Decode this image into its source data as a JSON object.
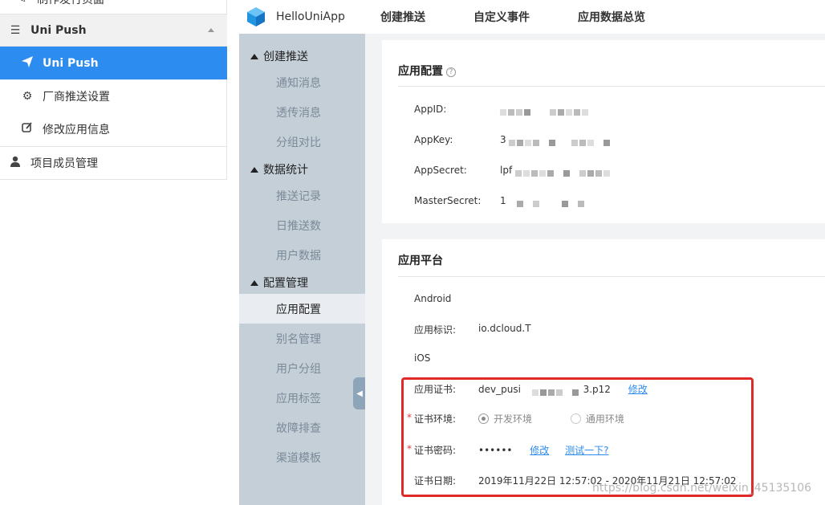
{
  "left_nav": {
    "top_item_label": "制作发行页面",
    "group_label": "Uni Push",
    "active_label": "Uni Push",
    "sub_items": [
      "厂商推送设置",
      "修改应用信息"
    ],
    "member_label": "项目成员管理"
  },
  "header": {
    "app_name": "HelloUniApp",
    "tabs": [
      "创建推送",
      "自定义事件",
      "应用数据总览"
    ]
  },
  "section_nav": {
    "groups": [
      {
        "label": "创建推送",
        "items": [
          "通知消息",
          "透传消息",
          "分组对比"
        ]
      },
      {
        "label": "数据统计",
        "items": [
          "推送记录",
          "日推送数",
          "用户数据"
        ]
      },
      {
        "label": "配置管理",
        "items": [
          "应用配置",
          "别名管理",
          "用户分组",
          "应用标签",
          "故障排查",
          "渠道模板"
        ]
      }
    ],
    "active_item": "应用配置"
  },
  "app_config": {
    "title": "应用配置",
    "help_icon": "question-circle-icon",
    "rows": [
      {
        "label": "AppID:",
        "prefix": ""
      },
      {
        "label": "AppKey:",
        "prefix": "3"
      },
      {
        "label": "AppSecret:",
        "prefix": "lpf"
      },
      {
        "label": "MasterSecret:",
        "prefix": "1"
      }
    ]
  },
  "platform": {
    "title": "应用平台",
    "android_label": "Android",
    "app_id_label": "应用标识:",
    "app_id_value": "io.dcloud.T",
    "ios_label": "iOS",
    "cert_label": "应用证书:",
    "cert_prefix": "dev_pusi",
    "cert_suffix": "3.p12",
    "cert_modify": "修改",
    "env_label": "证书环境:",
    "env_options": [
      "开发环境",
      "通用环境"
    ],
    "env_selected": "开发环境",
    "pwd_label": "证书密码:",
    "pwd_value": "••••••",
    "pwd_modify": "修改",
    "pwd_test": "测试一下?",
    "date_label": "证书日期:",
    "date_value": "2019年11月22日 12:57:02 - 2020年11月21日 12:57:02"
  },
  "watermark": "https://blog.csdn.net/weixin_45135106",
  "colors": {
    "accent": "#2d8cf0",
    "highlight": "#e02a2a",
    "required": "#e4393c"
  }
}
